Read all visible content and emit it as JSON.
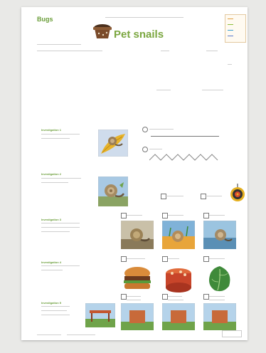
{
  "header": {
    "section": "Bugs",
    "title": "Pet snails"
  },
  "legend": {
    "colors": [
      "#e0a040",
      "#8cbf3a",
      "#3aa0d0",
      "#5a7acc"
    ],
    "labels": [
      "",
      "",
      "",
      ""
    ]
  },
  "intro": {
    "line1": "",
    "line2": "",
    "label_a": "",
    "label_b": "",
    "check_a": "",
    "check_b": ""
  },
  "investigations": [
    {
      "title": "Investigation 1",
      "question": ""
    },
    {
      "title": "Investigation 2",
      "question": ""
    },
    {
      "title": "Investigation 3",
      "question": "",
      "keyword": ""
    },
    {
      "title": "Investigation 4",
      "question": ""
    },
    {
      "title": "Investigation 5",
      "question": "",
      "keyword": ""
    }
  ],
  "inv1": {
    "opt_a": "",
    "opt_b": ""
  },
  "inv2": {
    "label_a": "",
    "label_b": ""
  },
  "inv3": {
    "options": [
      "",
      "",
      ""
    ]
  },
  "inv4": {
    "options": [
      "",
      "",
      ""
    ]
  },
  "inv5": {
    "options": [
      "",
      "",
      ""
    ]
  },
  "footer": {
    "left": "",
    "right": ""
  },
  "icons": {
    "pot": "flowerpot-icon",
    "target": "target-icon",
    "snail": "snail-icon"
  }
}
